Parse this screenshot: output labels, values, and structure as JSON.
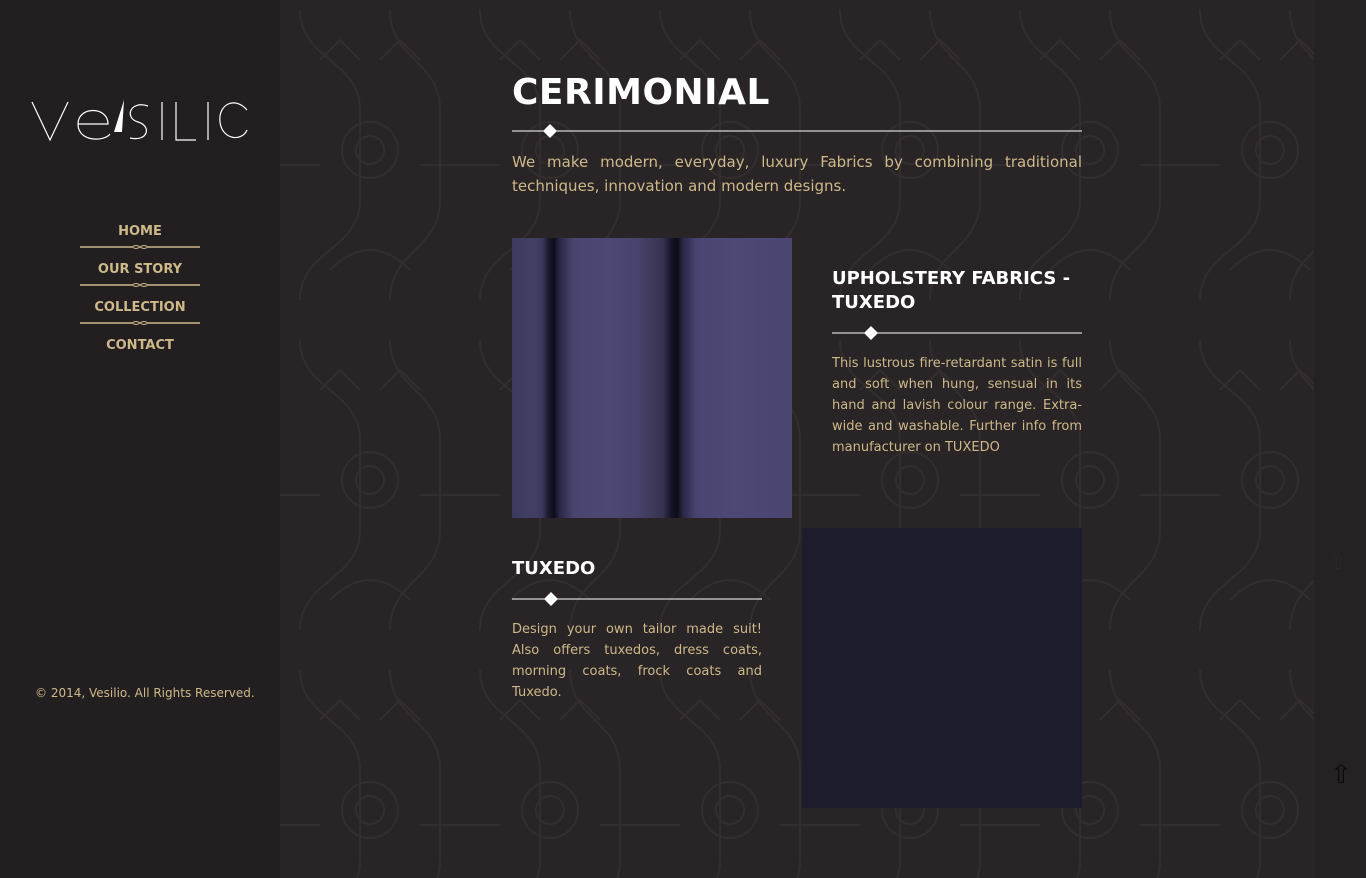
{
  "brand": {
    "logo_text": "Vesilio"
  },
  "nav": {
    "items": [
      {
        "label": "HOME"
      },
      {
        "label": "OUR STORY"
      },
      {
        "label": "COLLECTION"
      },
      {
        "label": "CONTACT"
      }
    ]
  },
  "footer": {
    "copyright": "© 2014, Vesilio. All Rights Reserved."
  },
  "page": {
    "title": "CERIMONIAL",
    "intro": "We make modern, everyday, luxury Fabrics by combining traditional techniques, innovation and modern designs."
  },
  "cards": [
    {
      "title": "UPHOLSTERY FABRICS - TUXEDO",
      "text": "This lustrous fire-retardant satin is full and soft when hung, sensual in its hand and lavish colour range. Extra-wide and washable. Further info from manufacturer on TUXEDO"
    },
    {
      "title": "TUXEDO",
      "text": "Design your own tailor made suit! Also offers tuxedos, dress coats, morning coats, frock coats and Tuxedo."
    }
  ],
  "icons": {
    "scroll_up": "up-arrow-icon",
    "divider": "diamond-icon",
    "nav_separator": "ornament-divider-icon"
  },
  "colors": {
    "accent_gold": "#cdb98a",
    "title_white": "#ffffff",
    "sidebar_bg": "#231f20",
    "main_bg": "#292425"
  }
}
